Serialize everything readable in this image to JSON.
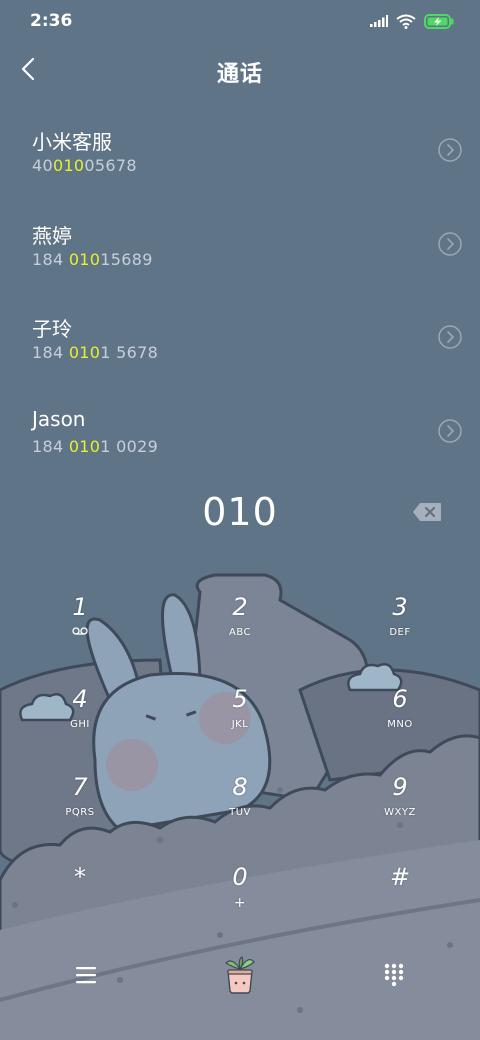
{
  "status": {
    "time": "2:36"
  },
  "header": {
    "title": "通话"
  },
  "contacts": [
    {
      "name": "小米客服",
      "number": [
        "40",
        "010",
        "05678"
      ]
    },
    {
      "name": "燕婷",
      "number": [
        "184 ",
        "010",
        "15689"
      ]
    },
    {
      "name": "子玲",
      "number": [
        "184 ",
        "010",
        "1 5678"
      ]
    },
    {
      "name": "Jason",
      "number": [
        "184 ",
        "010",
        "1 0029"
      ]
    }
  ],
  "dialer": {
    "typed": "010"
  },
  "keypad": [
    {
      "digit": "1",
      "letters": ""
    },
    {
      "digit": "2",
      "letters": "ABC"
    },
    {
      "digit": "3",
      "letters": "DEF"
    },
    {
      "digit": "4",
      "letters": "GHI"
    },
    {
      "digit": "5",
      "letters": "JKL"
    },
    {
      "digit": "6",
      "letters": "MNO"
    },
    {
      "digit": "7",
      "letters": "PQRS"
    },
    {
      "digit": "8",
      "letters": "TUV"
    },
    {
      "digit": "9",
      "letters": "WXYZ"
    },
    {
      "digit": "*",
      "letters": ""
    },
    {
      "digit": "0",
      "letters": "+"
    },
    {
      "digit": "#",
      "letters": ""
    }
  ],
  "colors": {
    "highlight": "#e6f12c",
    "battery": "#4cd964",
    "background": "#5f7487"
  },
  "icons": {
    "back": "chevron-left-icon",
    "row_detail": "chevron-right-circle-icon",
    "delete": "backspace-icon",
    "voicemail": "voicemail-icon",
    "menu": "menu-icon",
    "plant": "plant-pot-icon",
    "dialpad": "dialpad-icon"
  }
}
